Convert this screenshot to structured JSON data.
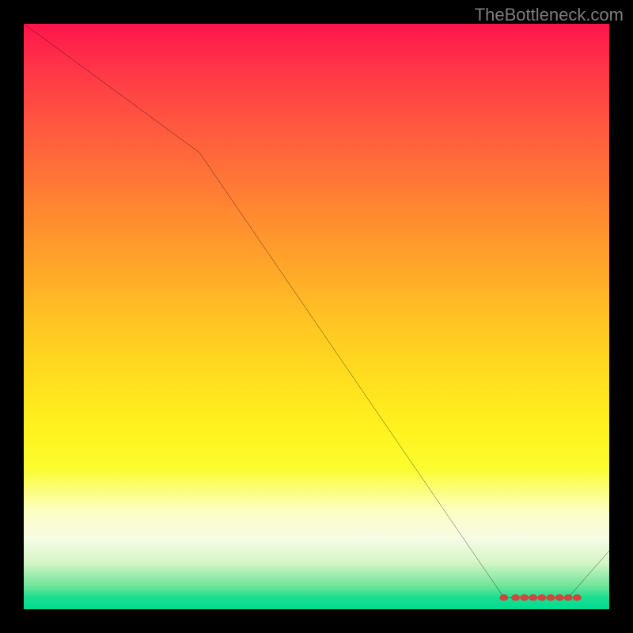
{
  "attribution": "TheBottleneck.com",
  "chart_data": {
    "type": "line",
    "title": "",
    "xlabel": "",
    "ylabel": "",
    "xlim": [
      0,
      100
    ],
    "ylim": [
      0,
      100
    ],
    "grid": false,
    "legend": false,
    "series": [
      {
        "name": "bottleneck-curve",
        "color": "#000000",
        "x": [
          0,
          30,
          82,
          93,
          100
        ],
        "values": [
          100,
          78,
          2,
          2,
          10
        ]
      }
    ],
    "markers": {
      "name": "optimal-range",
      "color": "#d1453b",
      "x": [
        82,
        84,
        85.5,
        87,
        88.5,
        90,
        91.5,
        93,
        94.5
      ],
      "values": [
        2,
        2,
        2,
        2,
        2,
        2,
        2,
        2,
        2
      ]
    },
    "gradient_stops": [
      {
        "pos": 0.0,
        "color": "#ff154c"
      },
      {
        "pos": 0.5,
        "color": "#ffd223"
      },
      {
        "pos": 0.83,
        "color": "#fdfec0"
      },
      {
        "pos": 1.0,
        "color": "#00db91"
      }
    ]
  }
}
